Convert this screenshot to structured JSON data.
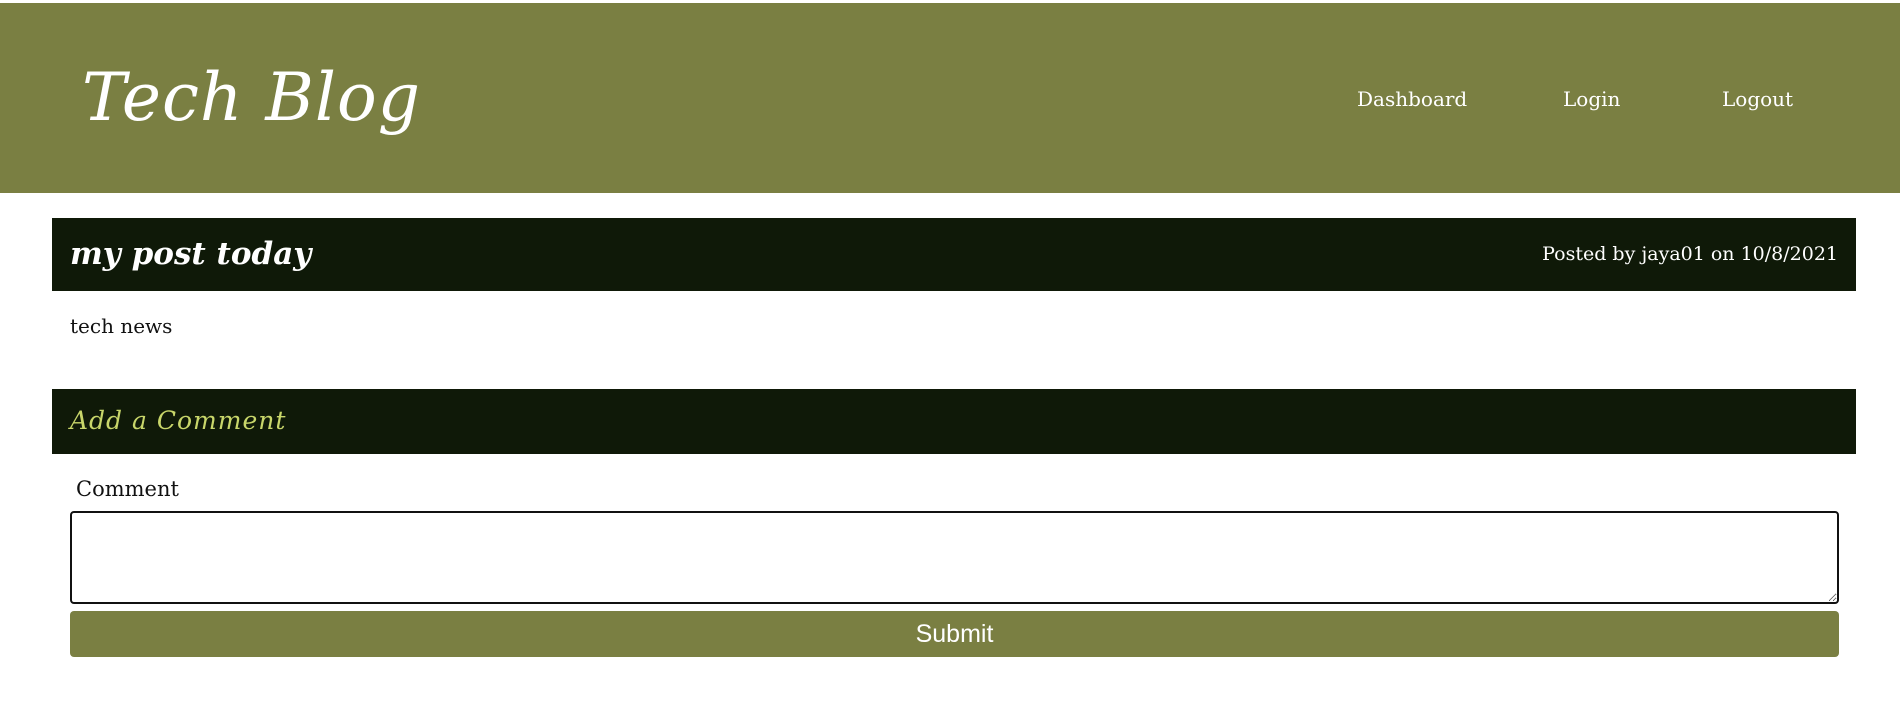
{
  "header": {
    "site_title": "Tech Blog",
    "nav": {
      "dashboard": "Dashboard",
      "login": "Login",
      "logout": "Logout"
    }
  },
  "post": {
    "title": "my post today",
    "meta": "Posted by jaya01 on 10/8/2021",
    "content": "tech news"
  },
  "comment_form": {
    "heading": "Add a Comment",
    "label": "Comment",
    "value": "",
    "submit_label": "Submit"
  },
  "colors": {
    "header_bg": "#7a7f42",
    "bar_bg": "#0f1908",
    "accent_text": "#c8d66a",
    "button_bg": "#7a7f42"
  }
}
